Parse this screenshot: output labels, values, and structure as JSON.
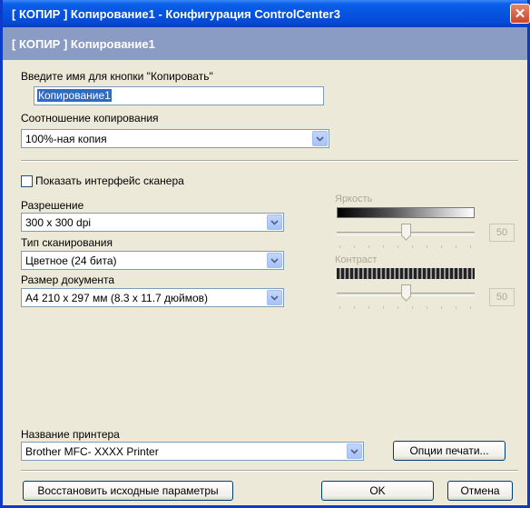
{
  "window": {
    "title": "[ КОПИР ]  Копирование1 - Конфигурация ControlCenter3",
    "header": "[ КОПИР ]  Копирование1",
    "close_glyph": "✕"
  },
  "button_name": {
    "label": "Введите имя для кнопки \"Копировать\"",
    "value": "Копирование1"
  },
  "copy_ratio": {
    "label": "Соотношение копирования",
    "value": "100%-ная копия"
  },
  "show_scanner_ui": {
    "label": "Показать интерфейс сканера",
    "checked": false
  },
  "resolution": {
    "label": "Разрешение",
    "value": "300 x 300 dpi"
  },
  "scan_type": {
    "label": "Тип сканирования",
    "value": "Цветное (24 бита)"
  },
  "document_size": {
    "label": "Размер документа",
    "value": "A4 210 x 297 мм (8.3 x 11.7 дюймов)"
  },
  "brightness": {
    "label": "Яркость",
    "value": "50"
  },
  "contrast": {
    "label": "Контраст",
    "value": "50"
  },
  "printer": {
    "label": "Название принтера",
    "value": "Brother MFC- XXXX   Printer",
    "options_button": "Опции печати..."
  },
  "footer": {
    "restore_button": "Восстановить исходные параметры",
    "ok_button": "OK",
    "cancel_button": "Отмена"
  },
  "colors": {
    "title_bar": "#0553e0",
    "header_band": "#8a9bc4",
    "dialog_bg": "#ece9d8",
    "selection": "#316ac5"
  }
}
